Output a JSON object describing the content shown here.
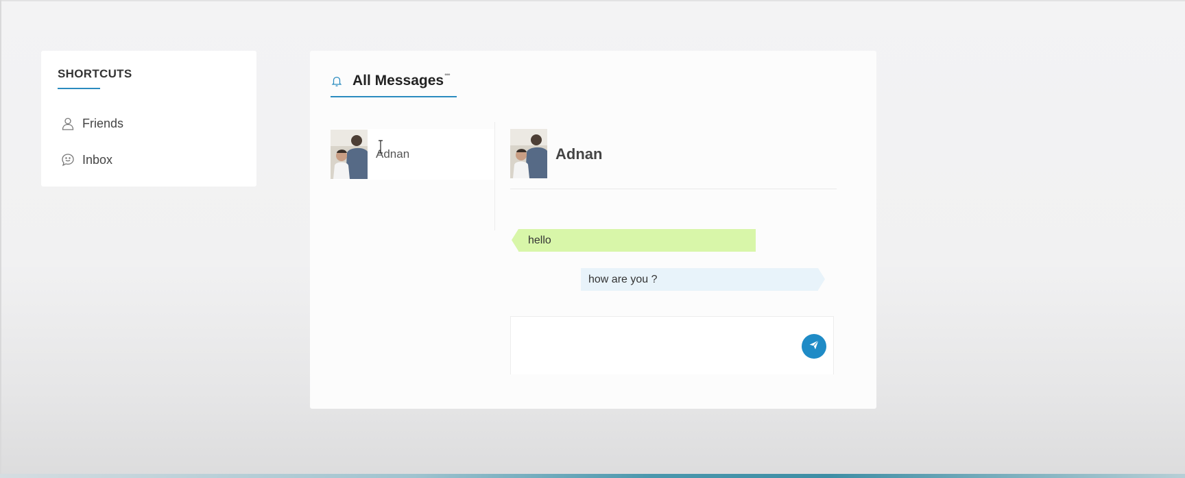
{
  "shortcuts": {
    "title": "SHORTCUTS",
    "items": [
      {
        "label": "Friends",
        "icon": "user-icon"
      },
      {
        "label": "Inbox",
        "icon": "chat-smile-icon"
      }
    ]
  },
  "messages": {
    "title": "All Messages",
    "title_suffix": "•••",
    "icon": "bell-icon",
    "contacts": [
      {
        "name": "Adnan"
      }
    ],
    "chat": {
      "name": "Adnan",
      "conversation": [
        {
          "direction": "incoming",
          "text": "hello"
        },
        {
          "direction": "outgoing",
          "text": "how are you ?"
        }
      ],
      "compose": {
        "value": "",
        "placeholder": ""
      },
      "send_icon": "paper-plane-icon"
    }
  },
  "colors": {
    "accent": "#2a8bbf",
    "incoming_bubble": "#d8f6a9",
    "outgoing_bubble": "#e8f3fa",
    "send_button": "#1f8bc6"
  }
}
